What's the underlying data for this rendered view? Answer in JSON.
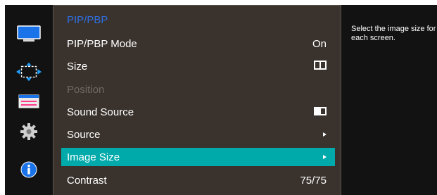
{
  "menu": {
    "title": "PIP/PBP",
    "items": [
      {
        "label": "PIP/PBP Mode",
        "value": "On",
        "state": "normal"
      },
      {
        "label": "Size",
        "value": "",
        "state": "normal",
        "value_icon": "side-by-side-size-icon"
      },
      {
        "label": "Position",
        "value": "",
        "state": "disabled"
      },
      {
        "label": "Sound Source",
        "value": "",
        "state": "normal",
        "value_icon": "sound-source-icon"
      },
      {
        "label": "Source",
        "value": "",
        "state": "normal",
        "value_icon": "arrow-right-icon"
      },
      {
        "label": "Image Size",
        "value": "",
        "state": "selected",
        "value_icon": "arrow-right-icon"
      },
      {
        "label": "Contrast",
        "value": "75/75",
        "state": "normal"
      }
    ]
  },
  "description": "Select the image size for each screen.",
  "sidebar": {
    "icons": [
      "picture-icon",
      "pip-pbp-icon",
      "onscreen-display-icon",
      "settings-gear-icon",
      "information-icon"
    ]
  },
  "colors": {
    "title": "#2f6fe0",
    "panel_bg": "#3a332d",
    "selected_bg": "#00aaaa",
    "sidebar_bg": "#121212",
    "disabled_text": "#6f6963"
  }
}
